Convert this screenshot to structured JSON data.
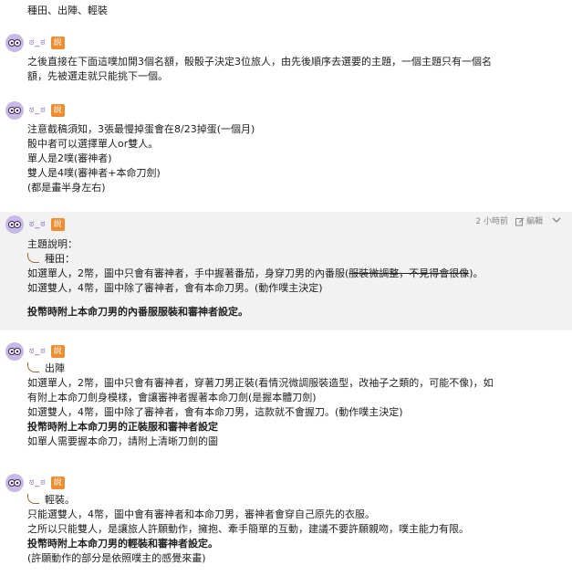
{
  "top_line": "種田、出陣、輕裝",
  "posts": [
    {
      "author": "ಠ_ಠ",
      "verb": "說",
      "lines": [
        "之後直接在下面這噗加開3個名額，骰骰子決定3位旅人，由先後順序去選要的主題，一個主題只有一個名",
        "額，先被選走就只能挑下一個。"
      ]
    },
    {
      "author": "ಠ_ಠ",
      "verb": "說",
      "lines": [
        "注意截稿須知，3張最慢掉蛋會在8/23掉蛋(一個月)",
        "骰中者可以選擇單人or雙人。",
        "單人是2噗(審神者)",
        "雙人是4噗(審神者+本命刀劍)",
        "(都是畫半身左右)"
      ]
    },
    {
      "author": "ಠ_ಠ",
      "verb": "說",
      "time": "2 小時前",
      "edit_label": "編輯",
      "lines": [
        "主題說明：",
        "種田：",
        "如選單人，2幣，圖中只會有審神者，手中握著番茄，身穿刀男的內番服(",
        "如選雙人，4幣，圖中除了審神者，會有本命刀男。(動作噗主決定)",
        "",
        "投幣時附上本命刀男的內番服服裝和審神者設定。"
      ],
      "strike_text": "服裝微調整，不見得會很像",
      "strike_suffix": ")。"
    },
    {
      "author": "ಠ_ಠ",
      "verb": "說",
      "lines": [
        "出陣",
        "如選單人，2幣，圖中只會有審神者，穿著刀男正裝(看情況微調服裝造型，改袖子之類的，可能不像)，如",
        "有附上本命刀劍身模樣，會讓審神者握著本命刀劍(是握本體刀劍)",
        "如選雙人，4幣，圖中除了審神者，會有本命刀男，這款就不會握刀。(動作噗主決定)",
        "投幣時附上本命刀男的正裝服和審神者設定",
        "如單人需要握本命刀，請附上清晰刀劍的圖"
      ]
    },
    {
      "author": "ಠ_ಠ",
      "verb": "說",
      "lines": [
        "輕裝。",
        "只能選雙人，4幣，圖中會有審神者和本命刀男，審神者會穿自己原先的衣服。",
        "之所以只能雙人，是讓旅人許願動作，擁抱、牽手簡單的互動，建議不要許願親吻，噗主能力有限。",
        "投幣時附上本命刀男的輕裝和審神者設定。",
        "(許願動作的部分是依照噗主的感覺來畫)"
      ]
    }
  ]
}
